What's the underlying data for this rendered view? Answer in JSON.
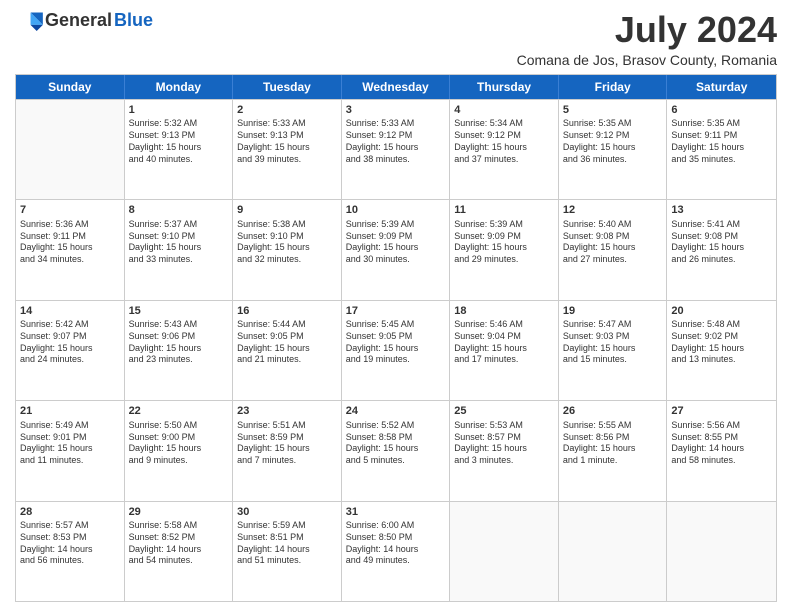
{
  "logo": {
    "general": "General",
    "blue": "Blue"
  },
  "title": "July 2024",
  "location": "Comana de Jos, Brasov County, Romania",
  "days": [
    "Sunday",
    "Monday",
    "Tuesday",
    "Wednesday",
    "Thursday",
    "Friday",
    "Saturday"
  ],
  "weeks": [
    [
      {
        "num": "",
        "text": ""
      },
      {
        "num": "1",
        "text": "Sunrise: 5:32 AM\nSunset: 9:13 PM\nDaylight: 15 hours\nand 40 minutes."
      },
      {
        "num": "2",
        "text": "Sunrise: 5:33 AM\nSunset: 9:13 PM\nDaylight: 15 hours\nand 39 minutes."
      },
      {
        "num": "3",
        "text": "Sunrise: 5:33 AM\nSunset: 9:12 PM\nDaylight: 15 hours\nand 38 minutes."
      },
      {
        "num": "4",
        "text": "Sunrise: 5:34 AM\nSunset: 9:12 PM\nDaylight: 15 hours\nand 37 minutes."
      },
      {
        "num": "5",
        "text": "Sunrise: 5:35 AM\nSunset: 9:12 PM\nDaylight: 15 hours\nand 36 minutes."
      },
      {
        "num": "6",
        "text": "Sunrise: 5:35 AM\nSunset: 9:11 PM\nDaylight: 15 hours\nand 35 minutes."
      }
    ],
    [
      {
        "num": "7",
        "text": "Sunrise: 5:36 AM\nSunset: 9:11 PM\nDaylight: 15 hours\nand 34 minutes."
      },
      {
        "num": "8",
        "text": "Sunrise: 5:37 AM\nSunset: 9:10 PM\nDaylight: 15 hours\nand 33 minutes."
      },
      {
        "num": "9",
        "text": "Sunrise: 5:38 AM\nSunset: 9:10 PM\nDaylight: 15 hours\nand 32 minutes."
      },
      {
        "num": "10",
        "text": "Sunrise: 5:39 AM\nSunset: 9:09 PM\nDaylight: 15 hours\nand 30 minutes."
      },
      {
        "num": "11",
        "text": "Sunrise: 5:39 AM\nSunset: 9:09 PM\nDaylight: 15 hours\nand 29 minutes."
      },
      {
        "num": "12",
        "text": "Sunrise: 5:40 AM\nSunset: 9:08 PM\nDaylight: 15 hours\nand 27 minutes."
      },
      {
        "num": "13",
        "text": "Sunrise: 5:41 AM\nSunset: 9:08 PM\nDaylight: 15 hours\nand 26 minutes."
      }
    ],
    [
      {
        "num": "14",
        "text": "Sunrise: 5:42 AM\nSunset: 9:07 PM\nDaylight: 15 hours\nand 24 minutes."
      },
      {
        "num": "15",
        "text": "Sunrise: 5:43 AM\nSunset: 9:06 PM\nDaylight: 15 hours\nand 23 minutes."
      },
      {
        "num": "16",
        "text": "Sunrise: 5:44 AM\nSunset: 9:05 PM\nDaylight: 15 hours\nand 21 minutes."
      },
      {
        "num": "17",
        "text": "Sunrise: 5:45 AM\nSunset: 9:05 PM\nDaylight: 15 hours\nand 19 minutes."
      },
      {
        "num": "18",
        "text": "Sunrise: 5:46 AM\nSunset: 9:04 PM\nDaylight: 15 hours\nand 17 minutes."
      },
      {
        "num": "19",
        "text": "Sunrise: 5:47 AM\nSunset: 9:03 PM\nDaylight: 15 hours\nand 15 minutes."
      },
      {
        "num": "20",
        "text": "Sunrise: 5:48 AM\nSunset: 9:02 PM\nDaylight: 15 hours\nand 13 minutes."
      }
    ],
    [
      {
        "num": "21",
        "text": "Sunrise: 5:49 AM\nSunset: 9:01 PM\nDaylight: 15 hours\nand 11 minutes."
      },
      {
        "num": "22",
        "text": "Sunrise: 5:50 AM\nSunset: 9:00 PM\nDaylight: 15 hours\nand 9 minutes."
      },
      {
        "num": "23",
        "text": "Sunrise: 5:51 AM\nSunset: 8:59 PM\nDaylight: 15 hours\nand 7 minutes."
      },
      {
        "num": "24",
        "text": "Sunrise: 5:52 AM\nSunset: 8:58 PM\nDaylight: 15 hours\nand 5 minutes."
      },
      {
        "num": "25",
        "text": "Sunrise: 5:53 AM\nSunset: 8:57 PM\nDaylight: 15 hours\nand 3 minutes."
      },
      {
        "num": "26",
        "text": "Sunrise: 5:55 AM\nSunset: 8:56 PM\nDaylight: 15 hours\nand 1 minute."
      },
      {
        "num": "27",
        "text": "Sunrise: 5:56 AM\nSunset: 8:55 PM\nDaylight: 14 hours\nand 58 minutes."
      }
    ],
    [
      {
        "num": "28",
        "text": "Sunrise: 5:57 AM\nSunset: 8:53 PM\nDaylight: 14 hours\nand 56 minutes."
      },
      {
        "num": "29",
        "text": "Sunrise: 5:58 AM\nSunset: 8:52 PM\nDaylight: 14 hours\nand 54 minutes."
      },
      {
        "num": "30",
        "text": "Sunrise: 5:59 AM\nSunset: 8:51 PM\nDaylight: 14 hours\nand 51 minutes."
      },
      {
        "num": "31",
        "text": "Sunrise: 6:00 AM\nSunset: 8:50 PM\nDaylight: 14 hours\nand 49 minutes."
      },
      {
        "num": "",
        "text": ""
      },
      {
        "num": "",
        "text": ""
      },
      {
        "num": "",
        "text": ""
      }
    ]
  ]
}
